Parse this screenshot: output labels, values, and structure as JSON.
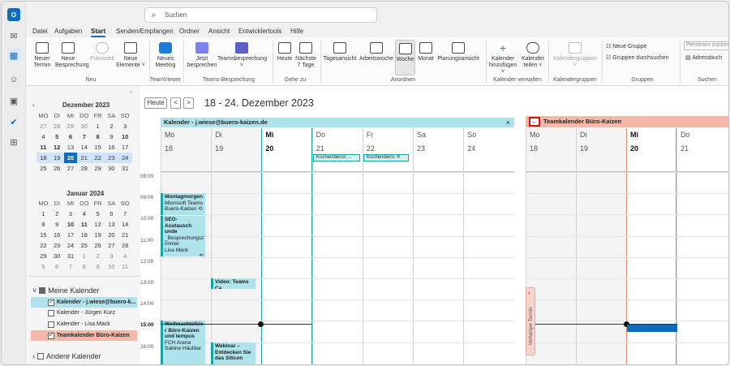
{
  "app": {
    "search_placeholder": "Suchen"
  },
  "menu": [
    "Datei",
    "Aufgaben",
    "Start",
    "Senden/Empfangen",
    "Ordner",
    "Ansicht",
    "Entwicklertools",
    "Hilfe"
  ],
  "ribbon": {
    "neuer_termin": "Neuer Termin",
    "neue_besprechung": "Neue Besprechung",
    "fokuszeit": "Fokuszeit",
    "neue_elemente": "Neue Elemente ˅",
    "grp_neu": "Neu",
    "neues_meeting": "Neues Meeting",
    "grp_teamviewer": "TeamViewer",
    "jetzt_besprechen": "Jetzt besprechen",
    "teamsbesprechung": "Teamsbesprechung",
    "grp_teams": "Teams-Besprechung",
    "heute": "Heute",
    "naechste7": "Nächste 7 Tage",
    "grp_gehezu": "Gehe zu",
    "tagesansicht": "Tagesansicht",
    "arbeitswoche": "Arbeitswoche",
    "woche": "Woche",
    "monat": "Monat",
    "planungsansicht": "Planungsansicht",
    "grp_anordnen": "Anordnen",
    "kalender_hinzufuegen": "Kalender hinzufügen ˅",
    "kalender_teilen": "Kalender teilen ˅",
    "grp_verwalten": "Kalender verwalten",
    "kalendergruppen": "Kalendergruppen",
    "grp_kalendergruppen": "Kalendergruppen",
    "neue_gruppe": "Neue Gruppe",
    "gruppen_durchsuchen": "Gruppen durchsuchen",
    "grp_gruppen": "Gruppen",
    "personen_suchen": "Personen suchen",
    "adressbuch": "Adressbuch",
    "grp_suchen": "Suchen"
  },
  "nav": {
    "month1": {
      "title": "Dezember 2023",
      "headers": [
        "MO",
        "DI",
        "MI",
        "DO",
        "FR",
        "SA",
        "SO"
      ],
      "rows": [
        [
          "27",
          "28",
          "29",
          "30",
          "1",
          "2",
          "3"
        ],
        [
          "4",
          "5",
          "6",
          "7",
          "8",
          "9",
          "10"
        ],
        [
          "11",
          "12",
          "13",
          "14",
          "15",
          "16",
          "17"
        ],
        [
          "18",
          "19",
          "20",
          "21",
          "22",
          "23",
          "24"
        ],
        [
          "25",
          "26",
          "27",
          "28",
          "29",
          "30",
          "31"
        ]
      ]
    },
    "month2": {
      "title": "Januar 2024",
      "headers": [
        "MO",
        "DI",
        "MI",
        "DO",
        "FR",
        "SA",
        "SO"
      ],
      "rows": [
        [
          "1",
          "2",
          "3",
          "4",
          "5",
          "6",
          "7"
        ],
        [
          "8",
          "9",
          "10",
          "11",
          "12",
          "13",
          "14"
        ],
        [
          "15",
          "16",
          "17",
          "18",
          "19",
          "20",
          "21"
        ],
        [
          "22",
          "23",
          "24",
          "25",
          "26",
          "27",
          "28"
        ],
        [
          "29",
          "30",
          "31",
          "1",
          "2",
          "3",
          "4"
        ],
        [
          "5",
          "6",
          "7",
          "8",
          "9",
          "10",
          "11"
        ]
      ]
    },
    "my_calendars": "Meine Kalender",
    "calendars": [
      "Kalender - j.wiese@buero-k...",
      "Kalender - Jürgen Kurz",
      "Kalender - Lisa Mack",
      "Teamkalender Büro-Kaizen"
    ],
    "other_calendars": "Andere Kalender"
  },
  "main": {
    "today_btn": "Heute",
    "prev": "<",
    "next": ">",
    "range": "18 - 24. Dezember 2023",
    "cal1_title": "Kalender - j.wiese@buero-kaizen.de",
    "cal2_title": "Teamkalender Büro-Kaizen",
    "days": [
      "Mo",
      "Di",
      "Mi",
      "Do",
      "Fr",
      "Sa",
      "So"
    ],
    "nums": [
      "18",
      "19",
      "20",
      "21",
      "22",
      "23",
      "24"
    ],
    "days2": [
      "Mo",
      "Di",
      "Mi",
      "Do"
    ],
    "nums2": [
      "18",
      "19",
      "20",
      "21"
    ],
    "times": [
      "08:00",
      "09:00",
      "10:00",
      "11:00",
      "12:00",
      "13:00",
      "14:00",
      "15:00",
      "16:00"
    ],
    "allday1": "Küchendienst ...",
    "allday2": "Küchendiens",
    "ev_montag_title": "Montagmorgen",
    "ev_montag_sub1": "Microsoft Teams",
    "ev_montag_sub2": "Buero-Kaizen",
    "ev_seo_title": "SEO-Austausch",
    "ev_seo_t2": "unde",
    "ev_seo_sub1": "_Besprechungsz",
    "ev_seo_sub2": "immer",
    "ev_seo_sub3": "Lisa Mack",
    "ev_video": "Video: Teams Ca",
    "ev_weih_t1": "Weihnachtsfeie",
    "ev_weih_t2": "r Büro-Kaizen",
    "ev_weih_t3": "und tempus",
    "ev_weih_sub1": "FCH Arena",
    "ev_weih_sub2": "Sabine Häußler",
    "ev_web_t1": "Webinar –",
    "ev_web_t2": "Entdecken Sie",
    "ev_web_t3": "das Silicon",
    "prev_appt": "Vorheriger Termin"
  },
  "colors": {
    "accent": "#0f6cbd",
    "team": "#f4b8a8",
    "teal": "#1aa3a3"
  }
}
